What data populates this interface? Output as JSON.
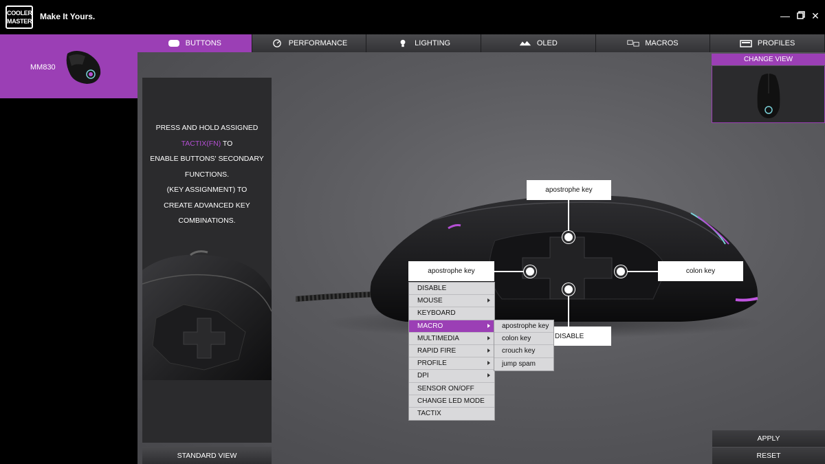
{
  "app": {
    "logo_line1": "COOLER",
    "logo_line2": "MASTER",
    "tagline": "Make It Yours."
  },
  "window_controls": {
    "minimize": "minimize-icon",
    "maximize": "maximize-icon",
    "close": "close-icon"
  },
  "device": {
    "name": "MM830"
  },
  "tabs": [
    {
      "label": "BUTTONS",
      "icon": "mouse-button-icon",
      "active": true
    },
    {
      "label": "PERFORMANCE",
      "icon": "gauge-icon",
      "active": false
    },
    {
      "label": "LIGHTING",
      "icon": "bulb-icon",
      "active": false
    },
    {
      "label": "OLED",
      "icon": "oled-icon",
      "active": false
    },
    {
      "label": "MACROS",
      "icon": "macro-icon",
      "active": false
    },
    {
      "label": "PROFILES",
      "icon": "folder-icon",
      "active": false
    }
  ],
  "info": {
    "line1_pre": "PRESS AND HOLD ASSIGNED ",
    "line1_highlight": "TACTIX(FN)",
    "line1_post": " TO",
    "line2": "ENABLE BUTTONS' SECONDARY FUNCTIONS.",
    "line3": "(KEY ASSIGNMENT) TO",
    "line4": "CREATE ADVANCED KEY COMBINATIONS."
  },
  "standard_view": "STANDARD VIEW",
  "change_view": "CHANGE VIEW",
  "apply": "APPLY",
  "reset": "RESET",
  "callouts": {
    "top": "apostrophe key",
    "left": "apostrophe key",
    "right": "colon key",
    "bottom": "DISABLE"
  },
  "menu": {
    "items": [
      {
        "label": "DISABLE",
        "submenu": false
      },
      {
        "label": "MOUSE",
        "submenu": true
      },
      {
        "label": "KEYBOARD",
        "submenu": false
      },
      {
        "label": "MACRO",
        "submenu": true,
        "hover": true
      },
      {
        "label": "MULTIMEDIA",
        "submenu": true
      },
      {
        "label": "RAPID FIRE",
        "submenu": true
      },
      {
        "label": "PROFILE",
        "submenu": true
      },
      {
        "label": "DPI",
        "submenu": true
      },
      {
        "label": "SENSOR ON/OFF",
        "submenu": false
      },
      {
        "label": "CHANGE LED MODE",
        "submenu": false
      },
      {
        "label": "TACTIX",
        "submenu": false
      }
    ],
    "macro_submenu": [
      "apostrophe key",
      "colon key",
      "crouch key",
      "jump spam"
    ]
  },
  "colors": {
    "accent": "#9b3fb5"
  }
}
